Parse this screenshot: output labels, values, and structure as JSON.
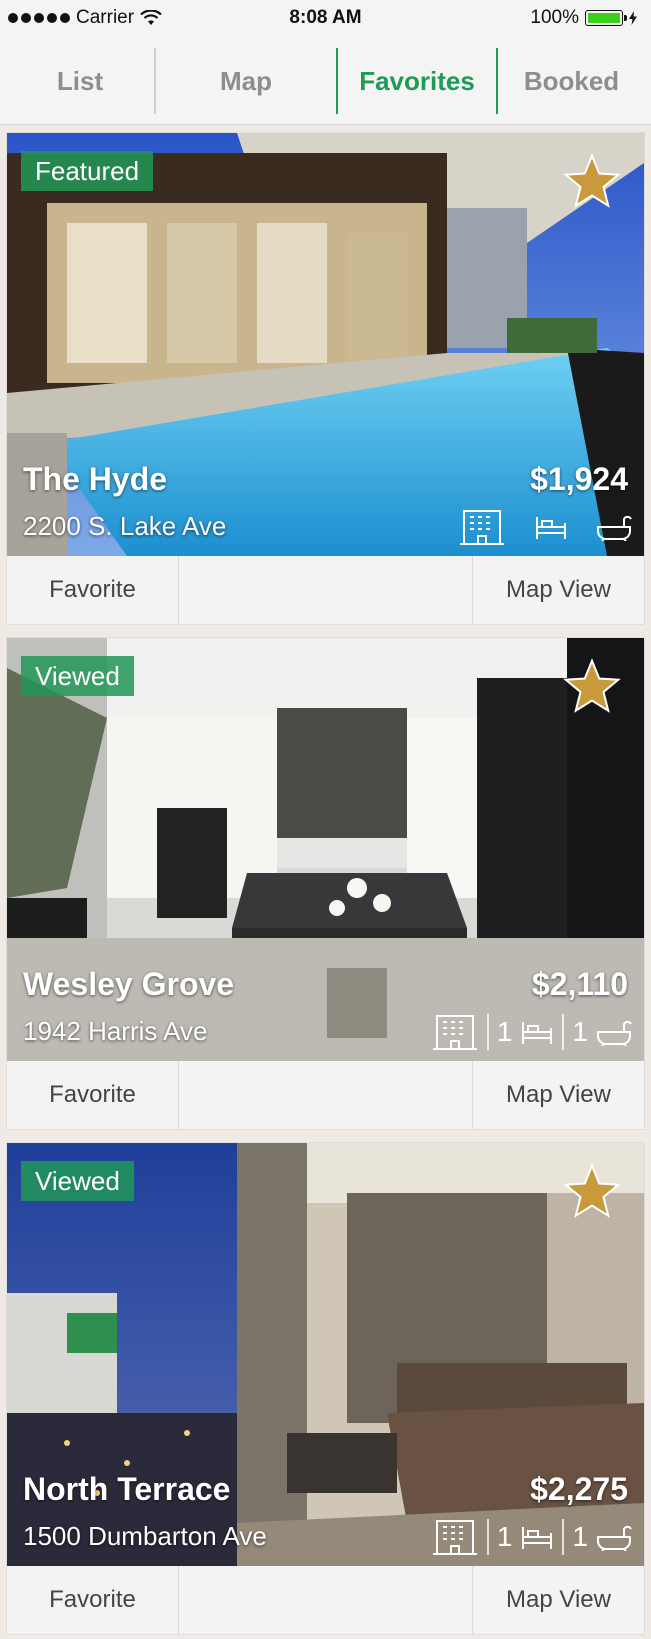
{
  "status": {
    "carrier": "Carrier",
    "time": "8:08 AM",
    "battery": "100%"
  },
  "tabs": [
    "List",
    "Map",
    "Favorites",
    "Booked"
  ],
  "active_tab": "Favorites",
  "colors": {
    "accent": "#1f9b57",
    "star": "#c99a3b"
  },
  "listings": [
    {
      "badge": "Featured",
      "name": "The Hyde",
      "address": "2200 S. Lake Ave",
      "price": "$1,924",
      "beds": "",
      "baths": "",
      "favorite": "Favorite",
      "map": "Map View"
    },
    {
      "badge": "Viewed",
      "name": "Wesley Grove",
      "address": "1942 Harris Ave",
      "price": "$2,110",
      "beds": "1",
      "baths": "1",
      "favorite": "Favorite",
      "map": "Map View"
    },
    {
      "badge": "Viewed",
      "name": "North Terrace",
      "address": "1500 Dumbarton Ave",
      "price": "$2,275",
      "beds": "1",
      "baths": "1",
      "favorite": "Favorite",
      "map": "Map View"
    }
  ]
}
